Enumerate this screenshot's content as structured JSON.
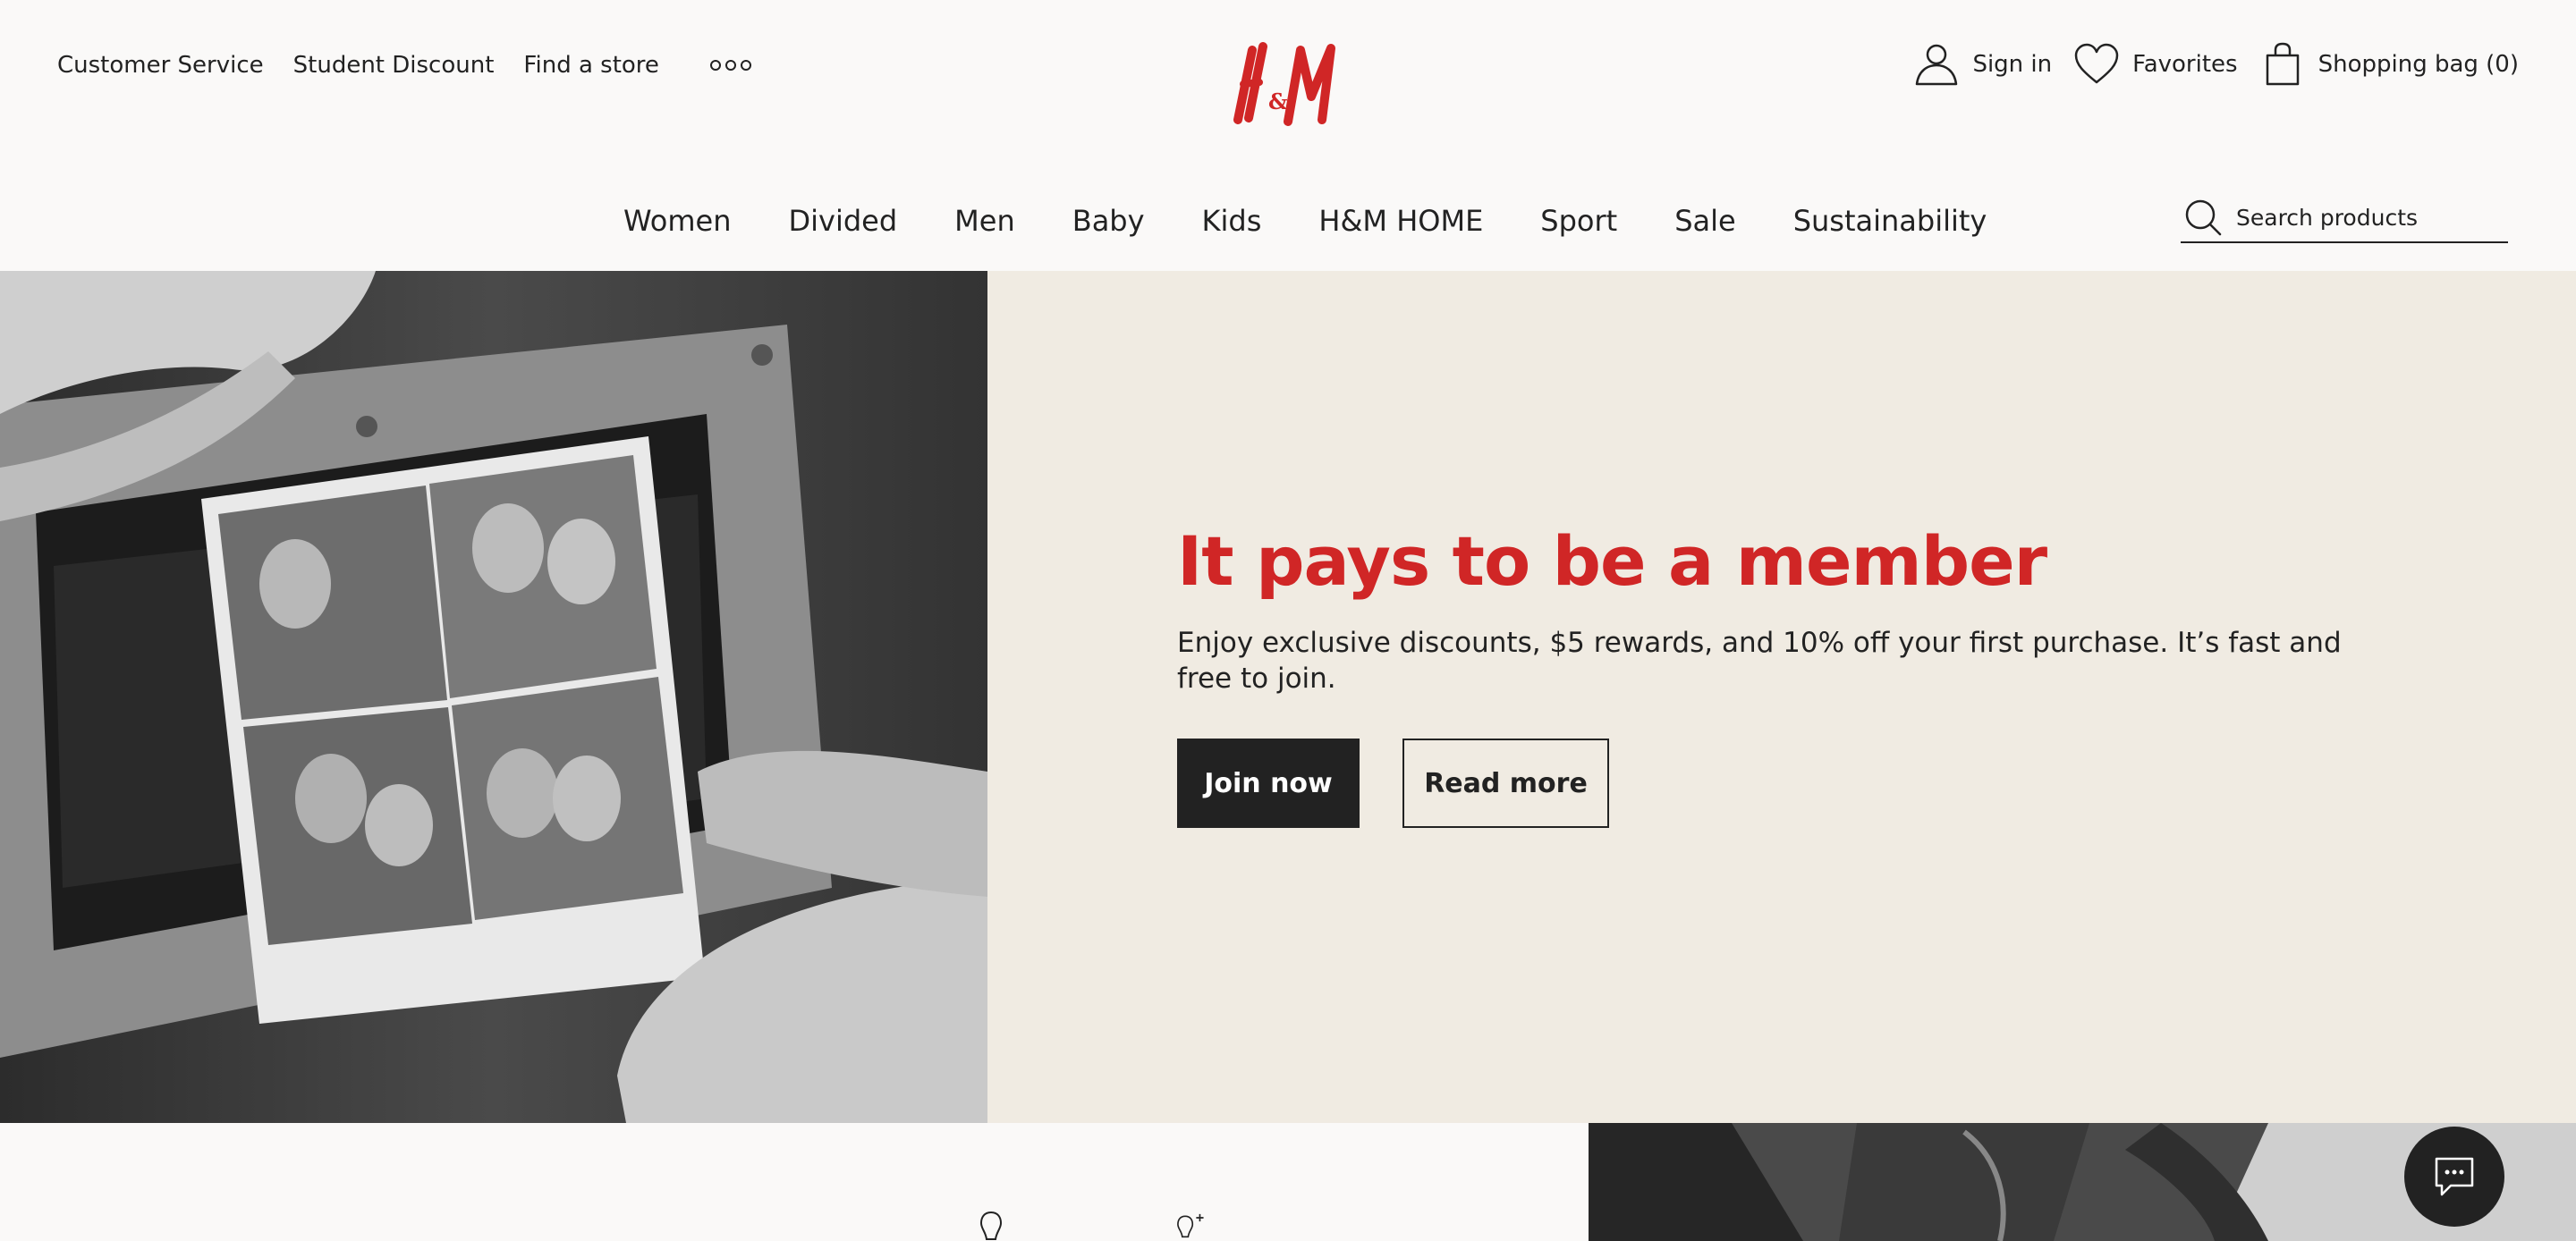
{
  "header": {
    "utility_links": [
      "Customer Service",
      "Student Discount",
      "Find a store"
    ],
    "more_icon": "more-dots-icon",
    "brand": "H&M",
    "account": {
      "sign_in": "Sign in",
      "favorites": "Favorites",
      "bag": "Shopping bag (0)"
    }
  },
  "nav": {
    "items": [
      "Women",
      "Divided",
      "Men",
      "Baby",
      "Kids",
      "H&M HOME",
      "Sport",
      "Sale",
      "Sustainability"
    ]
  },
  "search": {
    "placeholder": "Search products"
  },
  "hero": {
    "headline": "It pays to be a member",
    "subtext": "Enjoy exclusive discounts, $5 rewards, and 10% off your first purchase. It’s fast and free to join.",
    "join_label": "Join now",
    "read_more_label": "Read more"
  },
  "colors": {
    "brand_red": "#d02626",
    "hero_panel": "#f0ebe2",
    "page_bg": "#faf9f8",
    "dark": "#222222"
  },
  "icons": [
    "user-icon",
    "heart-icon",
    "bag-icon",
    "search-icon",
    "chat-icon",
    "more-dots-icon"
  ]
}
